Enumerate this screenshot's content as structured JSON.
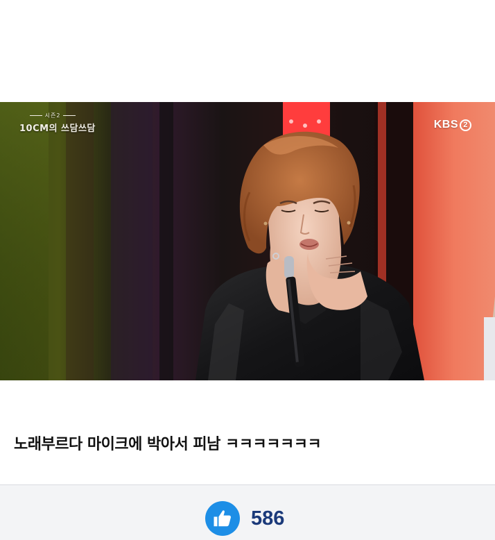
{
  "video": {
    "show_logo_subtitle": "시즌2",
    "show_logo_title": "10CM의 쓰담쓰담",
    "broadcaster": "KBS",
    "channel_number": "2",
    "colors": {
      "backdrop_green": "#3d4a12",
      "backdrop_dark": "#1a1414",
      "pillar_red": "#ff2a2a",
      "panel_coral": "#f0684e",
      "hair": "#b06a3a",
      "jacket": "#1c1c1e"
    }
  },
  "post": {
    "caption": "노래부르다 마이크에 박아서 피남 ㅋㅋㅋㅋㅋㅋㅋ"
  },
  "reactions": {
    "like_icon": "thumbs-up-icon",
    "like_count": "586",
    "like_color": "#1d8ee6",
    "count_color": "#1b3a7a"
  }
}
